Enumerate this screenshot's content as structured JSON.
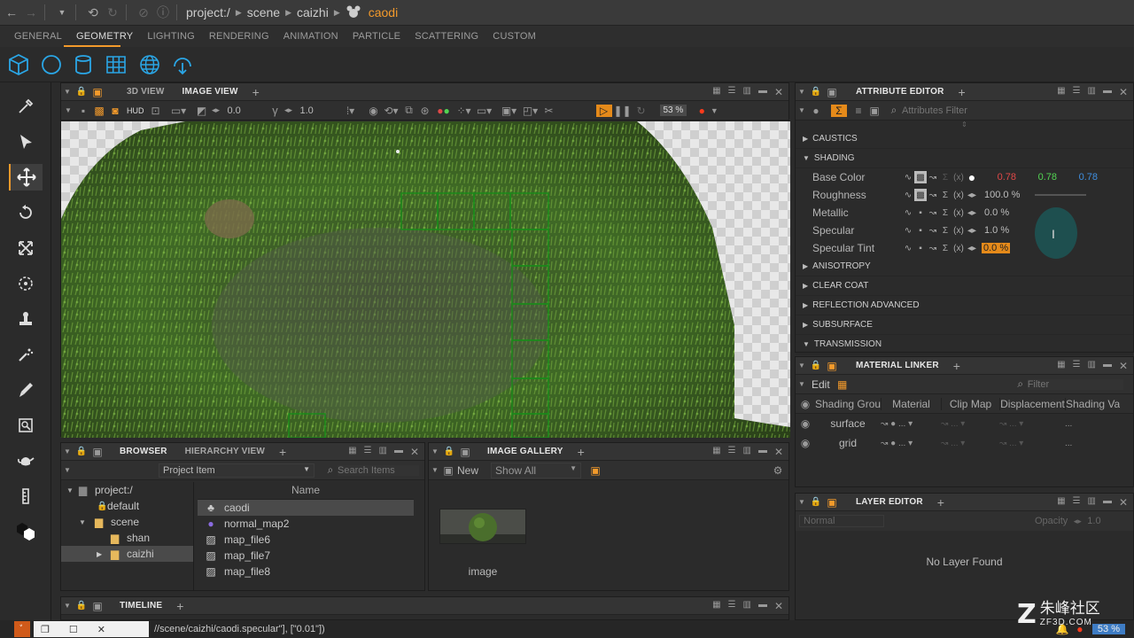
{
  "breadcrumb": [
    "project:/",
    "scene",
    "caizhi"
  ],
  "current_item": "caodi",
  "menu_tabs": [
    "GENERAL",
    "GEOMETRY",
    "LIGHTING",
    "RENDERING",
    "ANIMATION",
    "PARTICLE",
    "SCATTERING",
    "CUSTOM"
  ],
  "active_menu_tab": "GEOMETRY",
  "viewport": {
    "tabs": [
      "3D VIEW",
      "IMAGE VIEW"
    ],
    "active_tab": "IMAGE VIEW",
    "hud_label": "HUD",
    "exposure": "0.0",
    "gamma": "1.0",
    "zoom": "53 %"
  },
  "attribute_editor": {
    "title": "ATTRIBUTE EDITOR",
    "filter_placeholder": "Attributes Filter",
    "sections_before": [
      "CAUSTICS"
    ],
    "open_section": "SHADING",
    "properties": [
      {
        "name": "Base Color",
        "value_r": "0.78",
        "value_g": "0.78",
        "value_b": "0.78"
      },
      {
        "name": "Roughness",
        "value": "100.0 %"
      },
      {
        "name": "Metallic",
        "value": "0.0 %"
      },
      {
        "name": "Specular",
        "value": "1.0 %"
      },
      {
        "name": "Specular Tint",
        "value": "0.0 %"
      }
    ],
    "sections_after": [
      "ANISOTROPY",
      "CLEAR COAT",
      "REFLECTION ADVANCED",
      "SUBSURFACE",
      "TRANSMISSION"
    ]
  },
  "material_linker": {
    "title": "MATERIAL LINKER",
    "edit_label": "Edit",
    "filter_placeholder": "Filter",
    "columns": [
      "Shading Group",
      "Material",
      "Clip Map",
      "Displacement",
      "Shading Variable"
    ],
    "rows": [
      "surface",
      "grid"
    ]
  },
  "layer_editor": {
    "title": "LAYER EDITOR",
    "blend_mode": "Normal",
    "opacity_label": "Opacity",
    "opacity_value": "1.0",
    "empty_message": "No Layer Found"
  },
  "browser": {
    "tabs": [
      "BROWSER",
      "HIERARCHY VIEW"
    ],
    "filter_select": "Project Item",
    "search_placeholder": "Search Items",
    "column_name": "Name",
    "tree": [
      {
        "label": "project:/",
        "depth": 0
      },
      {
        "label": "default",
        "depth": 1
      },
      {
        "label": "scene",
        "depth": 1
      },
      {
        "label": "shan",
        "depth": 2
      },
      {
        "label": "caizhi",
        "depth": 2
      }
    ],
    "items": [
      "caodi",
      "normal_map2",
      "map_file6",
      "map_file7",
      "map_file8"
    ]
  },
  "gallery": {
    "title": "IMAGE GALLERY",
    "new_label": "New",
    "show_select": "Show All",
    "thumb_label": "image"
  },
  "timeline": {
    "title": "TIMELINE"
  },
  "status": {
    "command": "//scene/caizhi/caodi.specular\"], [\"0.01\"])",
    "zoom": "53 %"
  },
  "watermark": {
    "site": "ZF3D.COM",
    "name": "朱峰社区"
  },
  "colors": {
    "accent": "#f39a2b",
    "red": "#e04848",
    "green": "#52d452",
    "blue": "#3f8fe0",
    "cyan_icon": "#2aa6e6"
  }
}
